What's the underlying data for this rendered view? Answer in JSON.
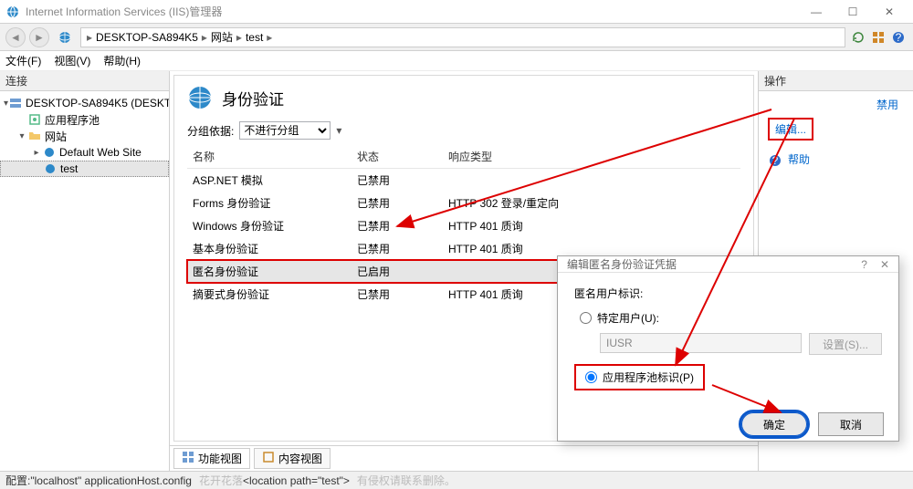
{
  "window": {
    "title": "Internet Information Services (IIS)管理器"
  },
  "win_buttons": {
    "min": "—",
    "max": "☐",
    "close": "✕"
  },
  "breadcrumb": {
    "root": "DESKTOP-SA894K5",
    "level1": "网站",
    "level2": "test",
    "sep": "▸"
  },
  "addr_icons": {
    "refresh": "⟳",
    "show_all": "▣",
    "help": "?"
  },
  "menu": {
    "file": "文件(F)",
    "view": "视图(V)",
    "help": "帮助(H)"
  },
  "left_panel": {
    "title": "连接",
    "root": "DESKTOP-SA894K5 (DESKTO",
    "pool": "应用程序池",
    "sites": "网站",
    "default_site": "Default Web Site",
    "test": "test"
  },
  "main": {
    "title": "身份验证",
    "group_label": "分组依据:",
    "group_value": "不进行分组",
    "cols": {
      "name": "名称",
      "status": "状态",
      "response": "响应类型"
    },
    "rows": [
      {
        "name": "ASP.NET 模拟",
        "status": "已禁用",
        "resp": ""
      },
      {
        "name": "Forms 身份验证",
        "status": "已禁用",
        "resp": "HTTP 302 登录/重定向"
      },
      {
        "name": "Windows 身份验证",
        "status": "已禁用",
        "resp": "HTTP 401 质询"
      },
      {
        "name": "基本身份验证",
        "status": "已禁用",
        "resp": "HTTP 401 质询"
      },
      {
        "name": "匿名身份验证",
        "status": "已启用",
        "resp": ""
      },
      {
        "name": "摘要式身份验证",
        "status": "已禁用",
        "resp": "HTTP 401 质询"
      }
    ],
    "tabs": {
      "features": "功能视图",
      "content": "内容视图"
    }
  },
  "actions": {
    "title": "操作",
    "disable": "禁用",
    "edit": "编辑...",
    "help": "帮助"
  },
  "dialog": {
    "title": "编辑匿名身份验证凭据",
    "help_q": "?",
    "close_x": "✕",
    "label": "匿名用户标识:",
    "radio_user": "特定用户(U):",
    "user_value": "IUSR",
    "set_btn": "设置(S)...",
    "radio_pool": "应用程序池标识(P)",
    "ok": "确定",
    "cancel": "取消"
  },
  "status": {
    "prefix": "配置:",
    "text": "\"localhost\" applicationHost.config",
    "wm1": "花开花落",
    "loc": "<location path=\"test\">",
    "wm2": "有侵权请联系删除。"
  }
}
